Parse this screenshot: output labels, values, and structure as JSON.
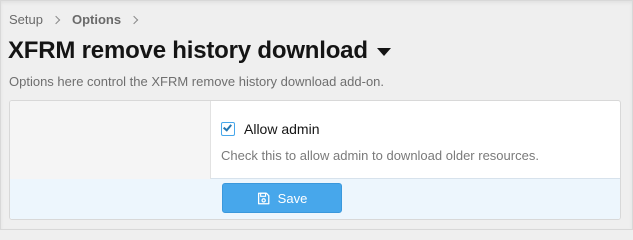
{
  "breadcrumb": {
    "items": [
      {
        "label": "Setup"
      },
      {
        "label": "Options"
      }
    ]
  },
  "header": {
    "title": "XFRM remove history download",
    "description": "Options here control the XFRM remove history download add-on."
  },
  "option": {
    "checkbox_label": "Allow admin",
    "checked": true,
    "hint": "Check this to allow admin to download older resources."
  },
  "footer": {
    "save_label": "Save",
    "save_icon": "save-icon"
  },
  "colors": {
    "accent": "#47a7eb",
    "footer_bg": "#edf6fd",
    "page_bg": "#efefef"
  }
}
